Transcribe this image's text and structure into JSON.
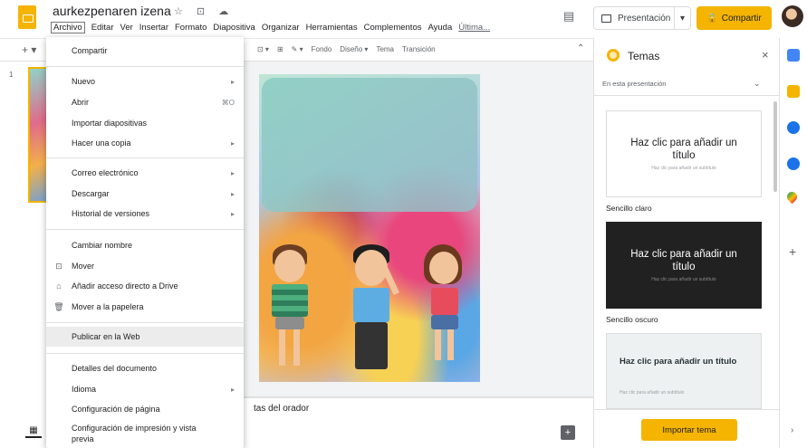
{
  "app": {
    "doc_title": "aurkezpenaren izena",
    "title_icons": "☆ ⊡ ☁"
  },
  "menubar": {
    "items": [
      "Archivo",
      "Editar",
      "Ver",
      "Insertar",
      "Formato",
      "Diapositiva",
      "Organizar",
      "Herramientas",
      "Complementos",
      "Ayuda"
    ],
    "last_edit": "Última..."
  },
  "header": {
    "present_label": "Presentación",
    "present_dropdown": "▾",
    "share_label": "Compartir",
    "share_icon": "🔒",
    "comment_icon": "▤"
  },
  "toolbar": {
    "items": [
      "⊡ ▾",
      "⊞",
      "✎ ▾",
      "Fondo",
      "Diseño ▾",
      "Tema",
      "Transición"
    ],
    "new_slide": "+ ▾",
    "collapse": "⌃"
  },
  "filmstrip": {
    "slide_number": "1"
  },
  "notes": {
    "label": "tas del orador"
  },
  "file_menu": {
    "items": [
      {
        "label": "Compartir",
        "shortcut": "",
        "icon": ""
      },
      {
        "label": "Nuevo",
        "shortcut": "▸",
        "icon": ""
      },
      {
        "label": "Abrir",
        "shortcut": "⌘O",
        "icon": ""
      },
      {
        "label": "Importar diapositivas",
        "shortcut": "",
        "icon": ""
      },
      {
        "label": "Hacer una copia",
        "shortcut": "▸",
        "icon": ""
      },
      {
        "label": "Correo electrónico",
        "shortcut": "▸",
        "icon": ""
      },
      {
        "label": "Descargar",
        "shortcut": "▸",
        "icon": ""
      },
      {
        "label": "Historial de versiones",
        "shortcut": "▸",
        "icon": ""
      },
      {
        "label": "Cambiar nombre",
        "shortcut": "",
        "icon": ""
      },
      {
        "label": "Mover",
        "shortcut": "",
        "icon": "⊡"
      },
      {
        "label": "Añadir acceso directo a Drive",
        "shortcut": "",
        "icon": "⌂"
      },
      {
        "label": "Mover a la papelera",
        "shortcut": "",
        "icon": "🗑"
      },
      {
        "label": "Publicar en la Web",
        "shortcut": "",
        "icon": ""
      },
      {
        "label": "Detalles del documento",
        "shortcut": "",
        "icon": ""
      },
      {
        "label": "Idioma",
        "shortcut": "▸",
        "icon": ""
      },
      {
        "label": "Configuración de página",
        "shortcut": "",
        "icon": ""
      },
      {
        "label": "Configuración de impresión y vista",
        "shortcut": "",
        "icon": ""
      }
    ],
    "last_item_line2": "previa",
    "highlighted": "Publicar en la Web"
  },
  "themes": {
    "title": "Temas",
    "close": "×",
    "filter": "En esta presentación",
    "filter_dd": "⌄",
    "cards": [
      {
        "title": "Haz clic para añadir un título",
        "subtitle": "Haz clic para añadir un subtítulo",
        "label": "Sencillo claro"
      },
      {
        "title": "Haz clic para añadir un título",
        "subtitle": "Haz clic para añadir un subtítulo",
        "label": "Sencillo oscuro"
      },
      {
        "title": "Haz clic para añadir un título",
        "subtitle": "Haz clic para añadir un subtítulo",
        "label": ""
      }
    ],
    "import_label": "Importar tema"
  },
  "side_panel": {
    "plus": "+",
    "chevron": "›"
  },
  "colors": {
    "accent": "#f4b400",
    "menu_highlight": "#ececec"
  }
}
